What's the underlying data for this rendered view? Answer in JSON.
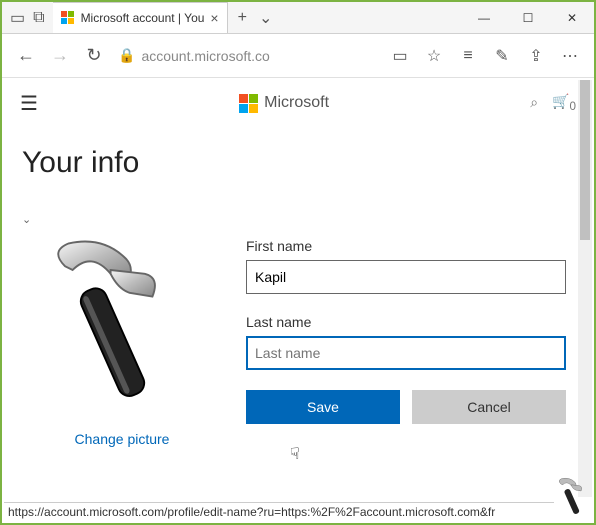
{
  "window": {
    "tab_title": "Microsoft account | You",
    "min": "—",
    "max": "☐",
    "close": "✕"
  },
  "toolbar": {
    "url": "account.microsoft.co",
    "back": "←",
    "forward": "→",
    "reload": "↻"
  },
  "header": {
    "brand": "Microsoft",
    "search": "⌕",
    "cart": "🛒",
    "cart_count": "0"
  },
  "page": {
    "title": "Your info",
    "change_picture": "Change picture",
    "first_name_label": "First name",
    "first_name_value": "Kapil",
    "last_name_label": "Last name",
    "last_name_placeholder": "Last name",
    "save": "Save",
    "cancel": "Cancel"
  },
  "status": {
    "url": "https://account.microsoft.com/profile/edit-name?ru=https:%2F%2Faccount.microsoft.com&fr"
  }
}
